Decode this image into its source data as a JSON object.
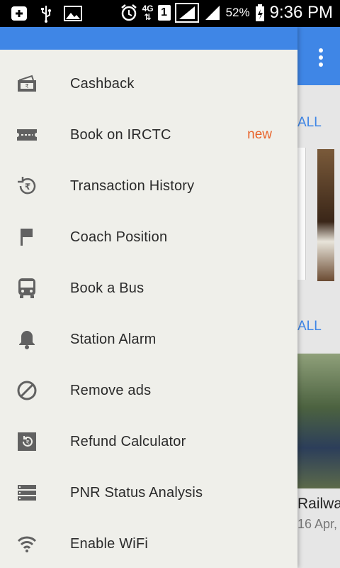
{
  "status_bar": {
    "network_type": "4G",
    "sim_slot": "1",
    "battery_percent": "52%",
    "time": "9:36 PM",
    "icons": [
      "notification-plus-icon",
      "usb-icon",
      "image-icon",
      "alarm-icon",
      "signal-icon",
      "signal-icon",
      "battery-charging-icon"
    ]
  },
  "background": {
    "section1_link": "ALL",
    "section2_link": "ALL",
    "card_title": "Railwa",
    "card_date": "16 Apr, "
  },
  "drawer": {
    "accent_color": "#3f86e6",
    "badge_color": "#e8632a",
    "items": [
      {
        "label": "Cashback",
        "icon": "cashback-icon",
        "badge": ""
      },
      {
        "label": "Book on IRCTC",
        "icon": "ticket-icon",
        "badge": "new"
      },
      {
        "label": "Transaction History",
        "icon": "rupee-history-icon",
        "badge": ""
      },
      {
        "label": "Coach Position",
        "icon": "flag-icon",
        "badge": ""
      },
      {
        "label": "Book a Bus",
        "icon": "bus-icon",
        "badge": ""
      },
      {
        "label": "Station Alarm",
        "icon": "bell-icon",
        "badge": ""
      },
      {
        "label": "Remove ads",
        "icon": "block-icon",
        "badge": ""
      },
      {
        "label": "Refund Calculator",
        "icon": "refund-icon",
        "badge": ""
      },
      {
        "label": "PNR Status Analysis",
        "icon": "storage-icon",
        "badge": ""
      },
      {
        "label": "Enable WiFi",
        "icon": "wifi-icon",
        "badge": ""
      }
    ]
  }
}
